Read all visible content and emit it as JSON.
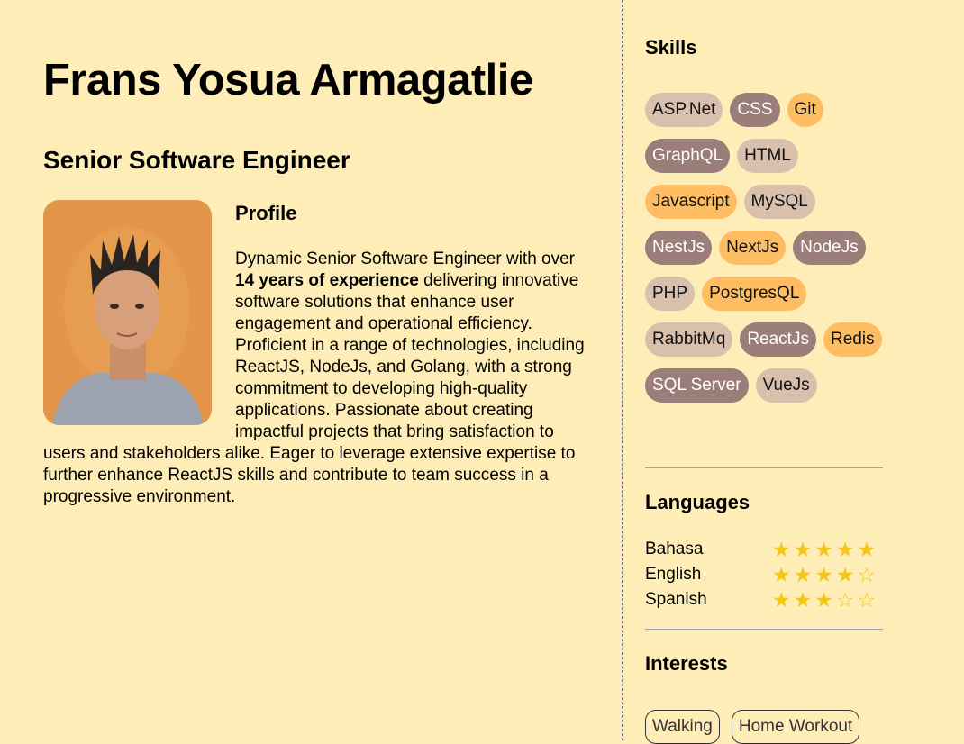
{
  "header": {
    "name": "Frans Yosua Armagatlie",
    "role": "Senior Software Engineer"
  },
  "profile": {
    "title": "Profile",
    "text_before": "Dynamic Senior Software Engineer with over ",
    "highlight": "14 years of experience",
    "text_after": " delivering innovative software solutions that enhance user engagement and operational efficiency. Proficient in a range of technologies, including ReactJS, NodeJs, and Golang, with a strong commitment to developing high-quality applications. Passionate about creating impactful projects that bring satisfaction to users and stakeholders alike. Eager to leverage extensive expertise to further enhance ReactJS skills and contribute to team success in a progressive environment."
  },
  "skills": {
    "title": "Skills",
    "items": [
      {
        "label": "ASP.Net",
        "color": "#d9c0ad"
      },
      {
        "label": "CSS",
        "color": "#9b7e7a"
      },
      {
        "label": "Git",
        "color": "#ffbd63"
      },
      {
        "label": "GraphQL",
        "color": "#9b7e7a"
      },
      {
        "label": "HTML",
        "color": "#d9c0ad"
      },
      {
        "label": "Javascript",
        "color": "#ffbd63"
      },
      {
        "label": "MySQL",
        "color": "#d9c0ad"
      },
      {
        "label": "NestJs",
        "color": "#9b7e7a"
      },
      {
        "label": "NextJs",
        "color": "#ffbd63"
      },
      {
        "label": "NodeJs",
        "color": "#9b7e7a"
      },
      {
        "label": "PHP",
        "color": "#d9c0ad"
      },
      {
        "label": "PostgresQL",
        "color": "#ffbd63"
      },
      {
        "label": "RabbitMq",
        "color": "#d9c0ad"
      },
      {
        "label": "ReactJs",
        "color": "#9b7e7a"
      },
      {
        "label": "Redis",
        "color": "#ffbd63"
      },
      {
        "label": "SQL Server",
        "color": "#9b7e7a"
      },
      {
        "label": "VueJs",
        "color": "#d9c0ad"
      }
    ]
  },
  "languages": {
    "title": "Languages",
    "items": [
      {
        "name": "Bahasa",
        "rating": 5,
        "max": 5
      },
      {
        "name": "English",
        "rating": 4,
        "max": 5
      },
      {
        "name": "Spanish",
        "rating": 3,
        "max": 5
      }
    ]
  },
  "interests": {
    "title": "Interests",
    "items": [
      "Walking",
      "Home Workout"
    ]
  },
  "colors": {
    "background": "#ffedb8",
    "star": "#f5c518"
  }
}
